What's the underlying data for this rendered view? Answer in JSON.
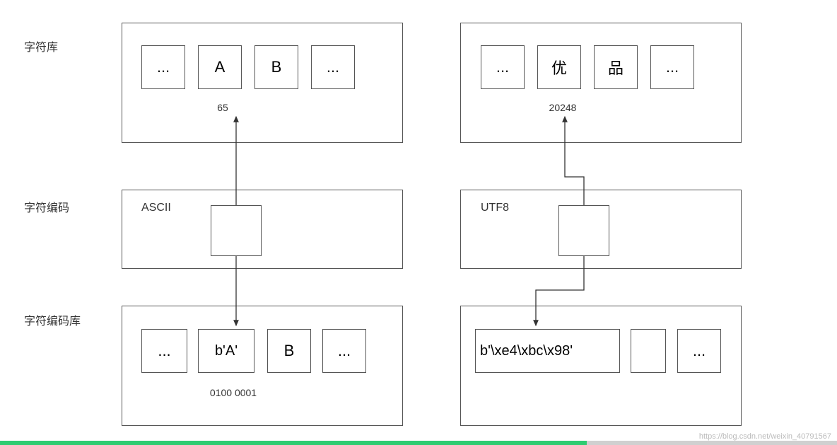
{
  "labels": {
    "row1": "字符库",
    "row2": "字符编码",
    "row3": "字符编码库"
  },
  "left": {
    "charset": [
      "...",
      "A",
      "B",
      "..."
    ],
    "codepoint": "65",
    "encoding_name": "ASCII",
    "encoded": [
      "...",
      "b'A'",
      "B",
      "..."
    ],
    "binary": "0100 0001"
  },
  "right": {
    "charset": [
      "...",
      "优",
      "品",
      "..."
    ],
    "codepoint": "20248",
    "encoding_name": "UTF8",
    "encoded": [
      "b'\\xe4\\xbc\\x98'",
      "",
      "..."
    ],
    "binary": ""
  },
  "watermark": "https://blog.csdn.net/weixin_40791567"
}
